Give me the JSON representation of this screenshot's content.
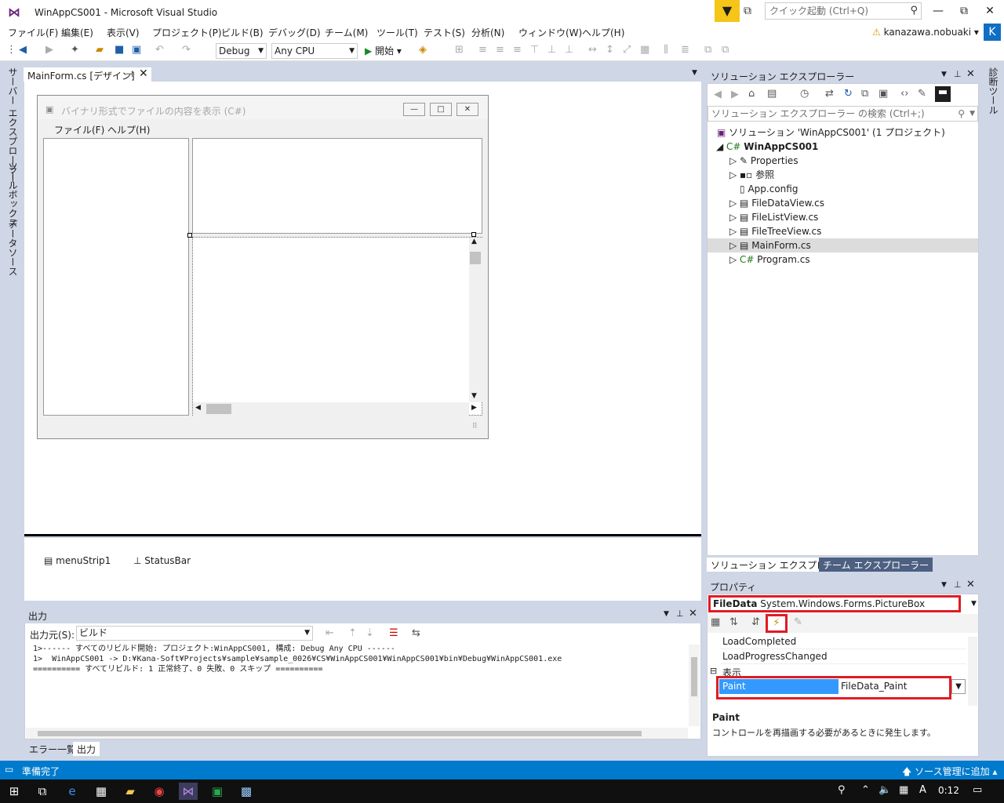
{
  "window": {
    "title": "WinAppCS001 - Microsoft Visual Studio",
    "quick_launch_placeholder": "クイック起動 (Ctrl+Q)",
    "user": "kanazawa.nobuaki",
    "avatar_letter": "K"
  },
  "menu": [
    "ファイル(F)",
    "編集(E)",
    "表示(V)",
    "プロジェクト(P)",
    "ビルド(B)",
    "デバッグ(D)",
    "チーム(M)",
    "ツール(T)",
    "テスト(S)",
    "分析(N)",
    "ウィンドウ(W)",
    "ヘルプ(H)"
  ],
  "toolbar": {
    "config": "Debug",
    "platform": "Any CPU",
    "start": "開始"
  },
  "left_tabs": [
    "サーバー エクスプローラー",
    "ツールボックス",
    "データソース"
  ],
  "right_tabs": [
    "診断ツール"
  ],
  "document": {
    "tab": "MainForm.cs [デザイン]"
  },
  "form": {
    "title": "バイナリ形式でファイルの内容を表示 (C#)",
    "menu": [
      "ファイル(F)",
      "ヘルプ(H)"
    ]
  },
  "tray": {
    "items": [
      "menuStrip1",
      "StatusBar"
    ]
  },
  "output": {
    "title": "出力",
    "source_label": "出力元(S):",
    "source_value": "ビルド",
    "lines": [
      "1>------ すべてのリビルド開始: プロジェクト:WinAppCS001, 構成: Debug Any CPU ------",
      "1>  WinAppCS001 -> D:¥Kana-Soft¥Projects¥sample¥sample_0026¥CS¥WinAppCS001¥WinAppCS001¥bin¥Debug¥WinAppCS001.exe",
      "========== すべてリビルド: 1 正常終了、0 失敗、0 スキップ =========="
    ],
    "tabs": [
      "エラー一覧",
      "出力"
    ]
  },
  "solution_explorer": {
    "title": "ソリューション エクスプローラー",
    "search_placeholder": "ソリューション エクスプローラー の検索 (Ctrl+;)",
    "solution": "ソリューション 'WinAppCS001' (1 プロジェクト)",
    "project": "WinAppCS001",
    "items": [
      "Properties",
      "参照",
      "App.config",
      "FileDataView.cs",
      "FileListView.cs",
      "FileTreeView.cs",
      "MainForm.cs",
      "Program.cs"
    ],
    "selected": "MainForm.cs",
    "tabs": [
      "ソリューション エクスプローラー",
      "チーム エクスプローラー"
    ]
  },
  "properties": {
    "title": "プロパティ",
    "object_name": "FileData",
    "object_type": "System.Windows.Forms.PictureBox",
    "rows": [
      {
        "name": "LoadCompleted",
        "value": ""
      },
      {
        "name": "LoadProgressChanged",
        "value": ""
      }
    ],
    "category": "表示",
    "paint_name": "Paint",
    "paint_value": "FileData_Paint",
    "desc_name": "Paint",
    "desc_text": "コントロールを再描画する必要があるときに発生します。"
  },
  "statusbar": {
    "text": "準備完了",
    "right": "ソース管理に追加"
  },
  "taskbar": {
    "clock": "0:12",
    "ime": "A"
  },
  "colors": {
    "accent": "#007acc",
    "highlight_border": "#e01b24",
    "selection": "#3399ff"
  }
}
